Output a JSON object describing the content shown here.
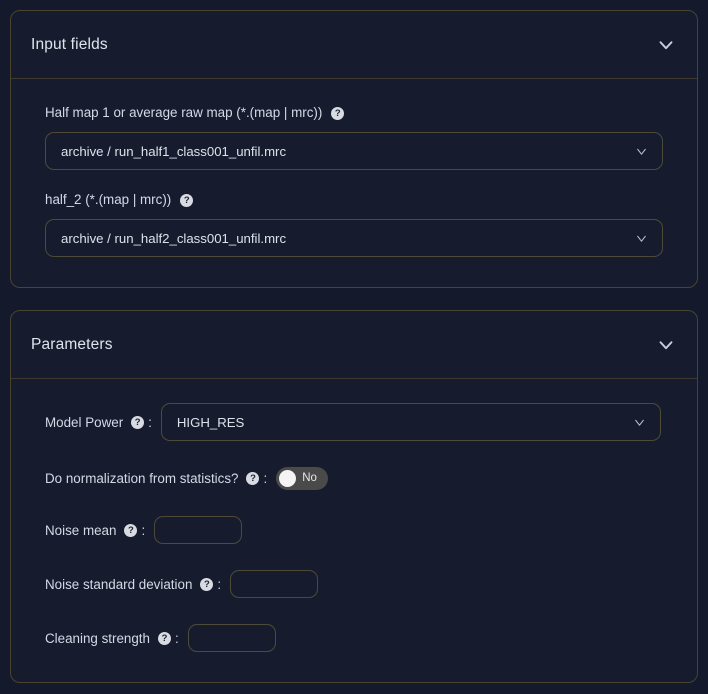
{
  "theme": {
    "page_background": "#141a2b",
    "panel_background": "#161c2e",
    "panel_border": "#4a4332",
    "text_primary": "#dfe3ec",
    "input_border": "#4e4a38",
    "toggle_track": "#4a4a4a",
    "toggle_knob": "#f4f4f4",
    "help_icon_background": "#d9dbe2"
  },
  "panels": [
    {
      "id": "input-fields",
      "title": "Input fields",
      "collapse_icon": "chevron-down-icon",
      "expanded": true
    },
    {
      "id": "parameters",
      "title": "Parameters",
      "collapse_icon": "chevron-down-icon",
      "expanded": true
    }
  ],
  "input_fields": {
    "half_map_1": {
      "label": "Half map 1 or average raw map (*.(map | mrc))",
      "help_icon": "question-mark-icon",
      "help_glyph": "?",
      "value": "archive / run_half1_class001_unfil.mrc",
      "dropdown_icon": "chevron-down-icon"
    },
    "half_2": {
      "label": "half_2 (*.(map | mrc))",
      "help_icon": "question-mark-icon",
      "help_glyph": "?",
      "value": "archive / run_half2_class001_unfil.mrc",
      "dropdown_icon": "chevron-down-icon"
    }
  },
  "parameters": {
    "model_power": {
      "label": "Model Power",
      "help_glyph": "?",
      "separator": ":",
      "value": "HIGH_RES",
      "dropdown_icon": "chevron-down-icon"
    },
    "do_normalization": {
      "label": "Do normalization from statistics?",
      "help_glyph": "?",
      "separator": ":",
      "toggle_state": "No",
      "toggle_on": false
    },
    "noise_mean": {
      "label": "Noise mean",
      "help_glyph": "?",
      "separator": ":",
      "value": "",
      "placeholder": ""
    },
    "noise_std": {
      "label": "Noise standard deviation",
      "help_glyph": "?",
      "separator": ":",
      "value": "",
      "placeholder": ""
    },
    "cleaning_strength": {
      "label": "Cleaning strength",
      "help_glyph": "?",
      "separator": ":",
      "value": "",
      "placeholder": ""
    }
  }
}
